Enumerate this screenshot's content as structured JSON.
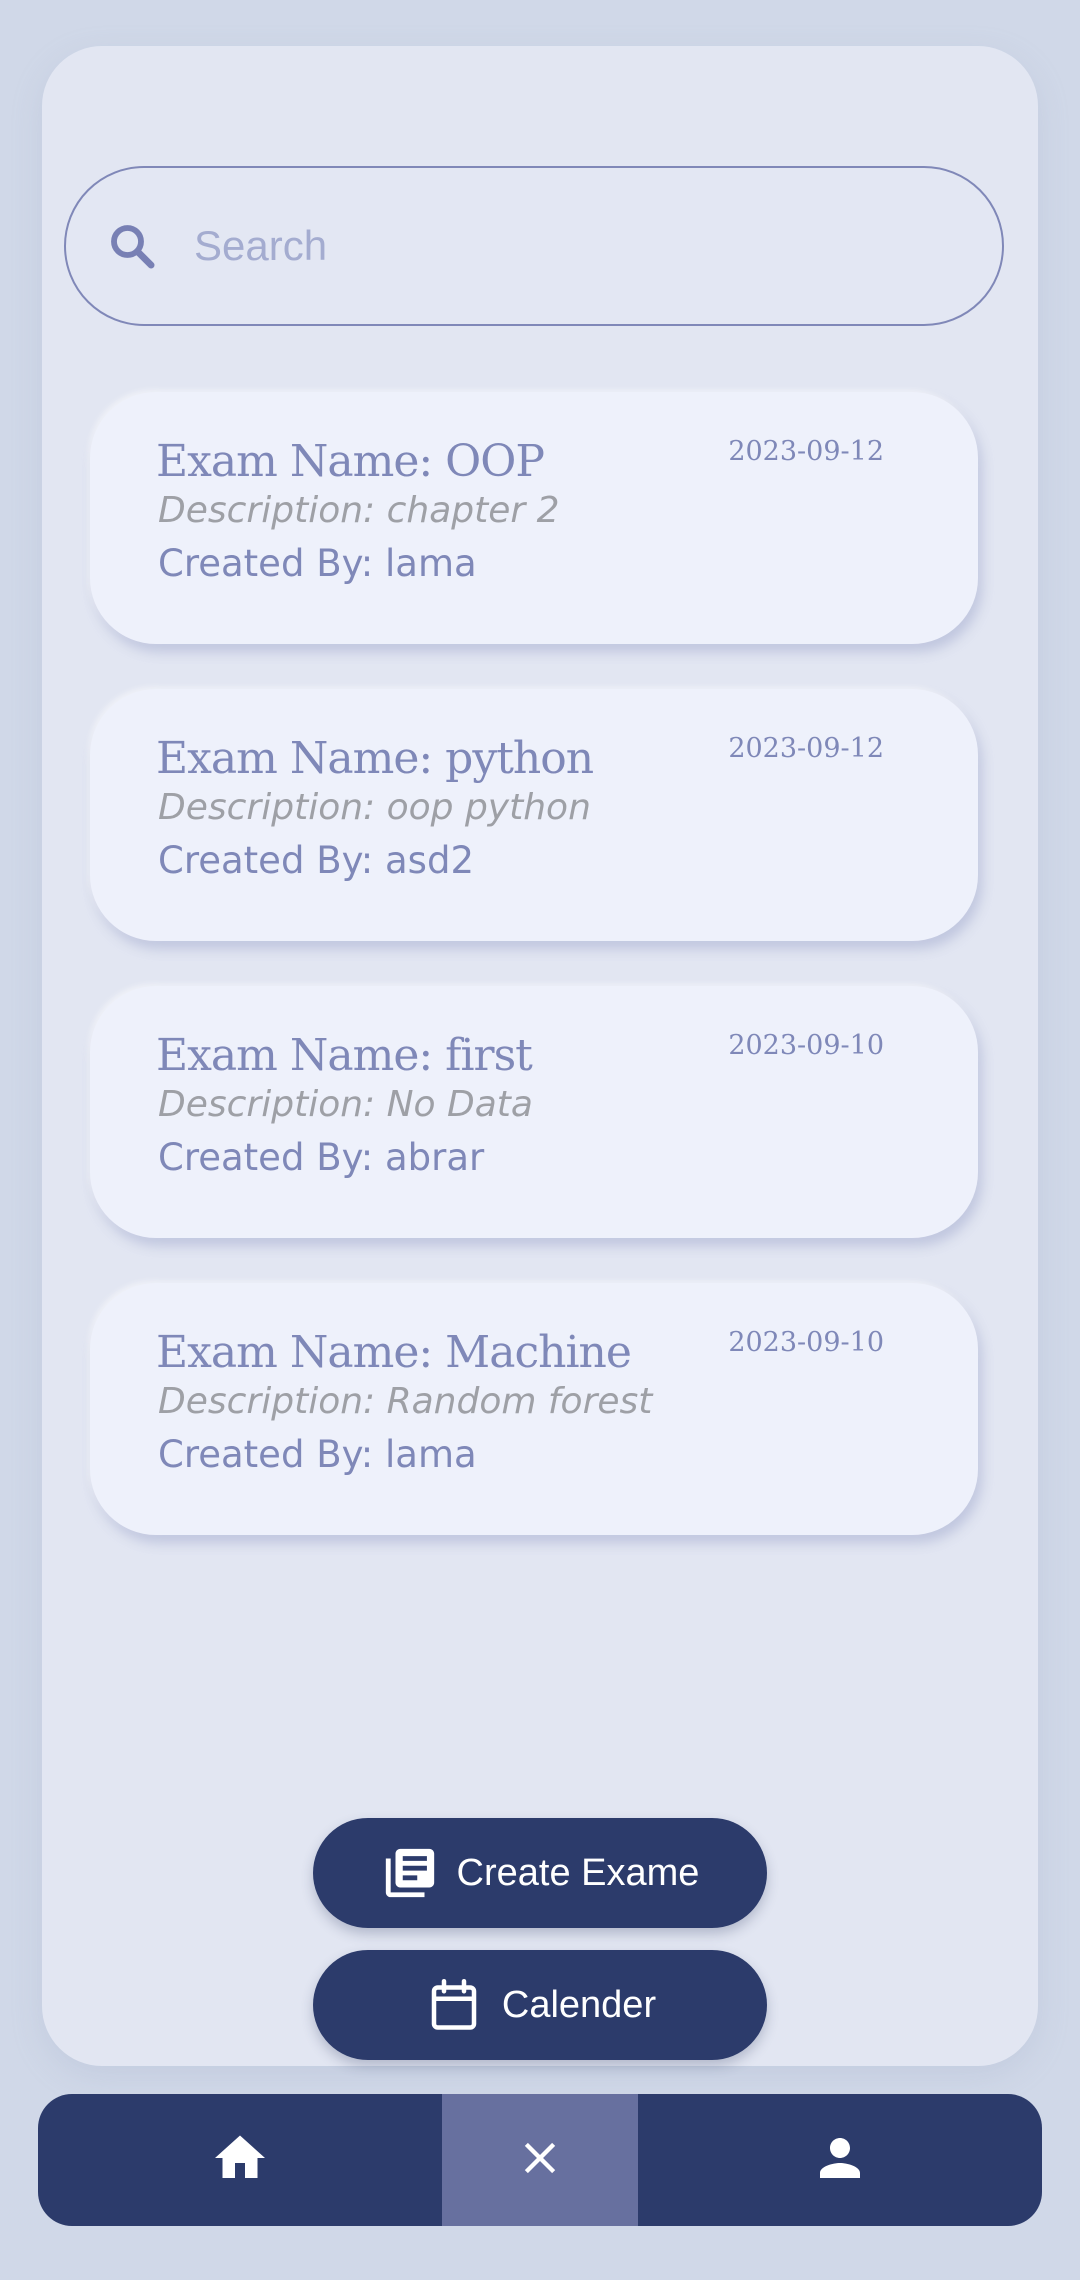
{
  "search": {
    "placeholder": "Search",
    "icon": "search-icon"
  },
  "exams": [
    {
      "title": "Exam Name: OOP",
      "date": "2023-09-12",
      "description": "Description: chapter 2",
      "created_by": "Created By: lama"
    },
    {
      "title": "Exam Name: python",
      "date": "2023-09-12",
      "description": "Description: oop python",
      "created_by": "Created By: asd2"
    },
    {
      "title": "Exam Name: first",
      "date": "2023-09-10",
      "description": "Description: No Data",
      "created_by": "Created By: abrar"
    },
    {
      "title": "Exam Name: Machine",
      "date": "2023-09-10",
      "description": "Description: Random forest",
      "created_by": "Created By: lama"
    }
  ],
  "actions": {
    "create_label": "Create Exame",
    "create_icon": "library-books-icon",
    "calendar_label": "Calender",
    "calendar_icon": "calendar-icon"
  },
  "nav": {
    "items": [
      "home-icon",
      "close-icon",
      "person-icon"
    ],
    "active": "close-icon"
  },
  "colors": {
    "primary": "#2c3b6b",
    "active_nav": "#67709f",
    "accent_text": "#7f88b8",
    "card_bg": "#eef1fb",
    "page_bg": "#d0d8e8"
  }
}
